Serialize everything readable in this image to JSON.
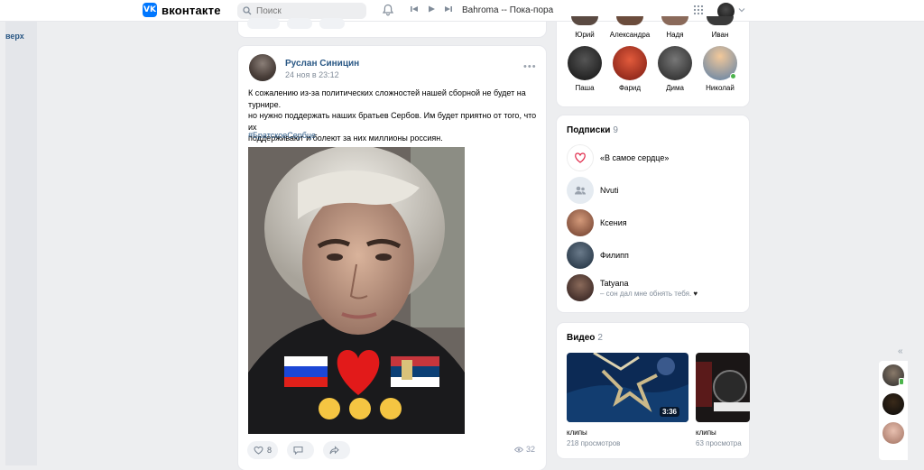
{
  "header": {
    "logo_text": "вконтакте",
    "logo_letters": "VK",
    "search_placeholder": "Поиск",
    "now_playing": "Bahroma -- Пока-пора"
  },
  "left": {
    "up_label": "верх"
  },
  "post": {
    "author": "Руслан Синицин",
    "date": "24 ноя в 23:12",
    "more": "•••",
    "text_lines": [
      "К сожалению из-за политических сложностей нашей сборной не будет на турнире.",
      "но нужно поддержать наших братьев Сербов. Им будет приятно от того, что их",
      "поддерживают и болеют за них миллионы россиян."
    ],
    "hashtag": "#БратскоеСербце",
    "likes": "8",
    "views": "32"
  },
  "friends": {
    "top_names": [
      "Юрий",
      "Александра",
      "Надя",
      "Иван"
    ],
    "items": [
      {
        "name": "Паша",
        "color": "#2b2b2b"
      },
      {
        "name": "Фарид",
        "color": "#c0392b"
      },
      {
        "name": "Дима",
        "color": "#4a4a4a"
      },
      {
        "name": "Николай",
        "color": "#b08a6a"
      }
    ]
  },
  "subscriptions": {
    "title": "Подписки",
    "count": "9",
    "items": [
      {
        "name": "«В самое сердце»",
        "status": ""
      },
      {
        "name": "Nvuti",
        "status": ""
      },
      {
        "name": "Ксения",
        "status": ""
      },
      {
        "name": "Филипп",
        "status": ""
      },
      {
        "name": "Tatyana",
        "status": "– сон дал мне обнять тебя."
      }
    ]
  },
  "videos": {
    "title": "Видео",
    "count": "2",
    "items": [
      {
        "label": "клипы",
        "views": "218 просмотров",
        "duration": "3:36"
      },
      {
        "label": "клипы",
        "views": "63 просмотра",
        "duration": ""
      }
    ]
  },
  "chat_collapse": "«",
  "colors": {
    "accent": "#0077ff",
    "link": "#2a5885",
    "online": "#4bb34b"
  }
}
